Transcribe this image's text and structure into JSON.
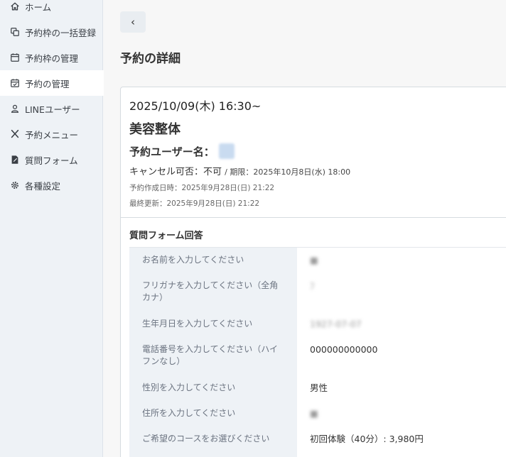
{
  "sidebar": {
    "items": [
      {
        "label": "ホーム",
        "icon": "home-icon"
      },
      {
        "label": "予約枠の一括登録",
        "icon": "copy-icon"
      },
      {
        "label": "予約枠の管理",
        "icon": "calendar-icon"
      },
      {
        "label": "予約の管理",
        "icon": "calendar-check-icon"
      },
      {
        "label": "LINEユーザー",
        "icon": "user-icon"
      },
      {
        "label": "予約メニュー",
        "icon": "utensils-icon"
      },
      {
        "label": "質問フォーム",
        "icon": "form-icon"
      },
      {
        "label": "各種設定",
        "icon": "gear-icon"
      }
    ]
  },
  "main": {
    "back_label": "‹",
    "page_title": "予約の詳細"
  },
  "reservation": {
    "datetime": "2025/10/09(木) 16:30~",
    "menu_name": "美容整体",
    "user_label": "予約ユーザー名：",
    "user_name": "■",
    "cancel_text": "キャンセル可否：不可",
    "deadline_text": "/ 期限：2025年10月8日(水) 18:00",
    "created_at": "予約作成日時：2025年9月28日(日) 21:22",
    "updated_at": "最終更新：2025年9月28日(日) 21:22"
  },
  "form": {
    "section_title": "質問フォーム回答",
    "rows": [
      {
        "question": "お名前を入力してください",
        "answer": "■",
        "blurred": true
      },
      {
        "question": "フリガナを入力してください（全角カナ）",
        "answer": "ﾌ",
        "blurred": true
      },
      {
        "question": "生年月日を入力してください",
        "answer": "1927-07-07",
        "blurred": true
      },
      {
        "question": "電話番号を入力してください（ハイフンなし）",
        "answer": "000000000000",
        "blurred": false
      },
      {
        "question": "性別を入力してください",
        "answer": "男性",
        "blurred": false
      },
      {
        "question": "住所を入力してください",
        "answer": "■",
        "blurred": true
      },
      {
        "question": "ご希望のコースをお選びください",
        "answer": "初回体験（40分）: 3,980円",
        "blurred": false
      }
    ]
  },
  "colors": {
    "sidebar_bg": "#eef2f6",
    "page_bg": "#f7f7f7",
    "card_bg": "#ffffff",
    "question_bg": "#eef2f6",
    "question_text": "#6b7380"
  }
}
